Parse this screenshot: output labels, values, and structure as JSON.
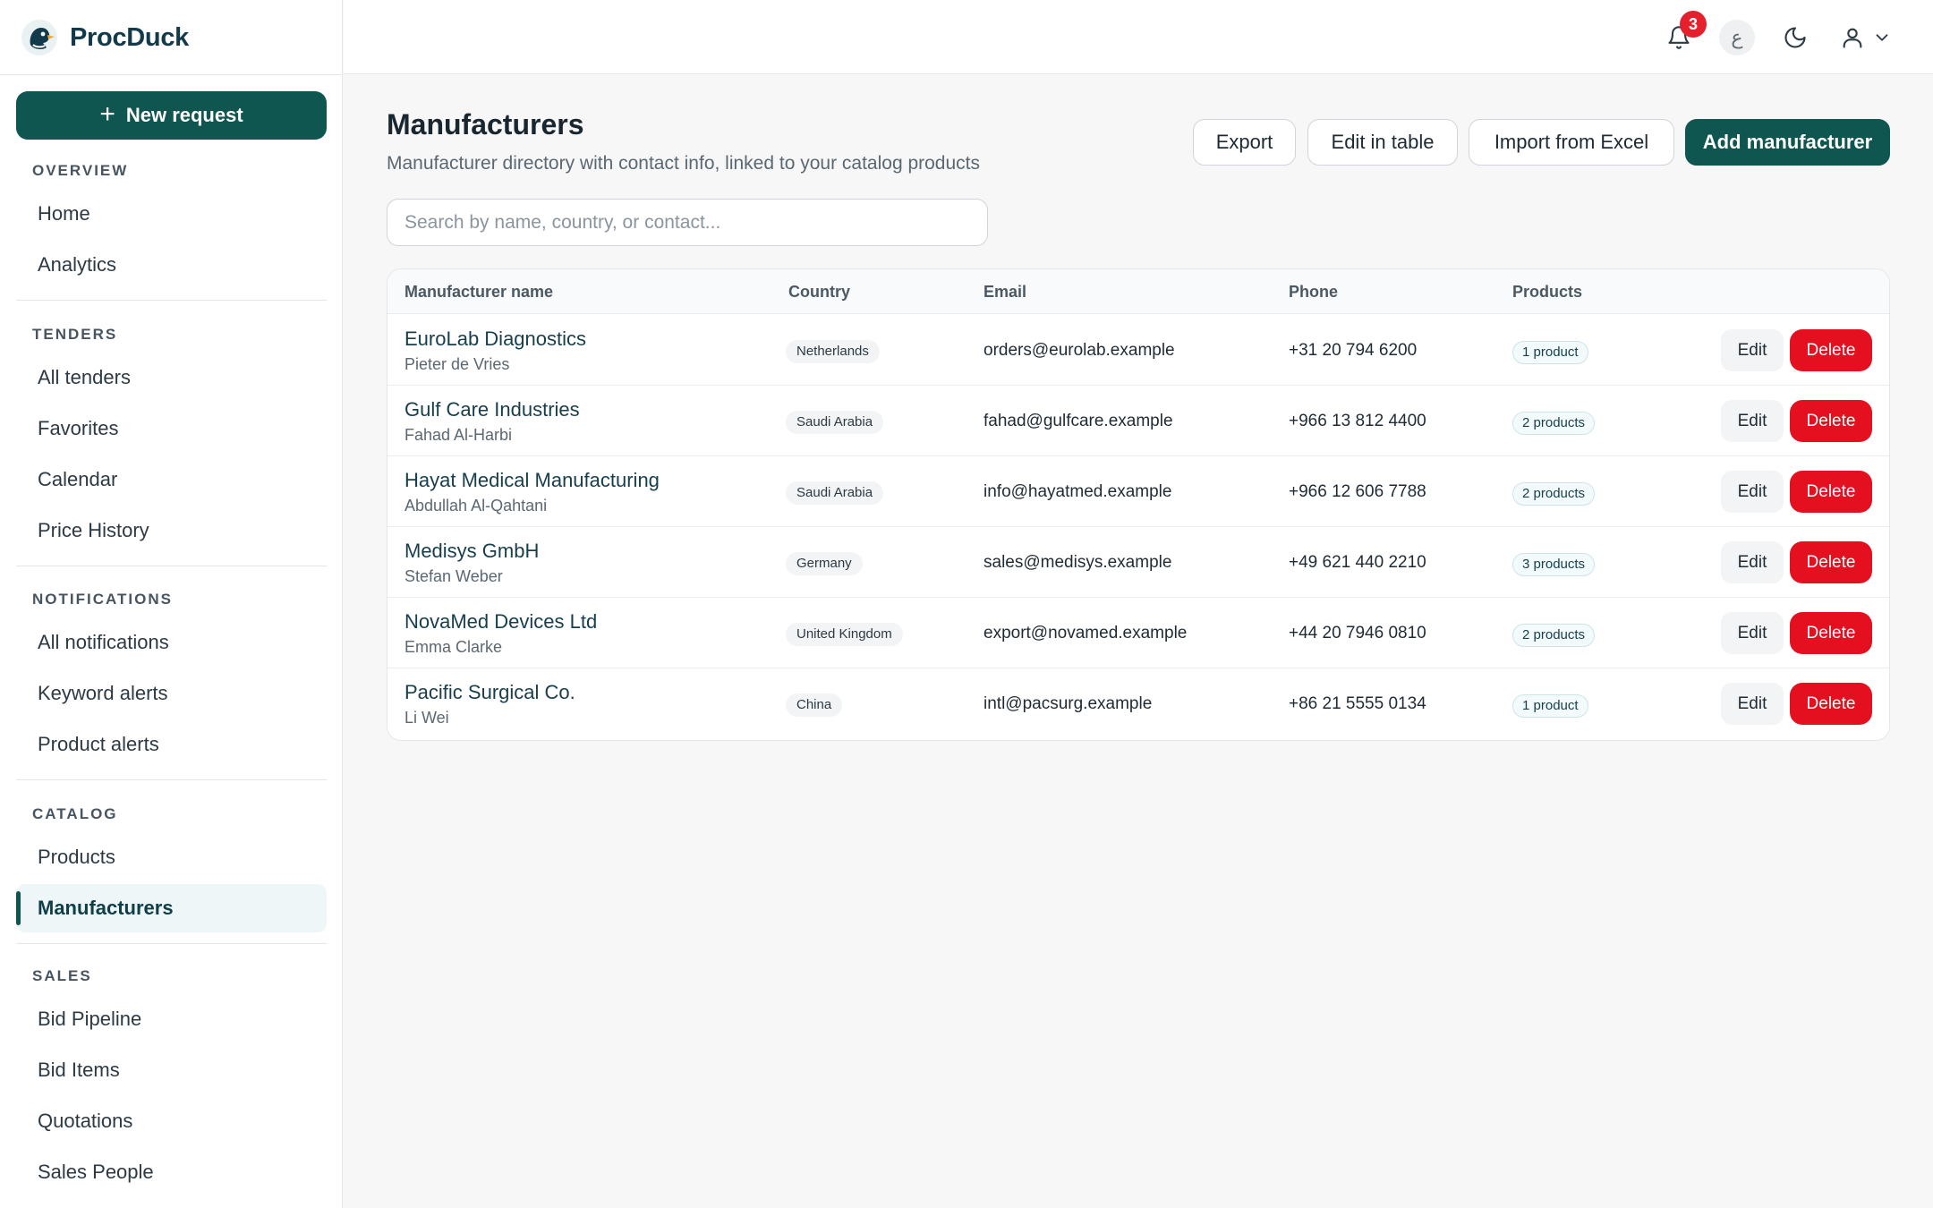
{
  "app": {
    "name": "ProcDuck"
  },
  "sidebar": {
    "new_request_label": "New request",
    "sections": [
      {
        "heading": "OVERVIEW",
        "items": [
          "Home",
          "Analytics"
        ]
      },
      {
        "heading": "TENDERS",
        "items": [
          "All tenders",
          "Favorites",
          "Calendar",
          "Price History"
        ]
      },
      {
        "heading": "NOTIFICATIONS",
        "items": [
          "All notifications",
          "Keyword alerts",
          "Product alerts"
        ]
      },
      {
        "heading": "CATALOG",
        "items": [
          "Products",
          "Manufacturers"
        ]
      },
      {
        "heading": "SALES",
        "items": [
          "Bid Pipeline",
          "Bid Items",
          "Quotations",
          "Sales People"
        ]
      }
    ],
    "active_item": "Manufacturers"
  },
  "topbar": {
    "notification_count": "3",
    "language_glyph": "ع",
    "icons": [
      "bell-icon",
      "moon-icon",
      "user-icon",
      "chevron-down-icon"
    ]
  },
  "page": {
    "title": "Manufacturers",
    "subtitle": "Manufacturer directory with contact info, linked to your catalog products",
    "actions": {
      "export": "Export",
      "edit_table": "Edit in table",
      "import": "Import from Excel",
      "add": "Add manufacturer"
    },
    "search_placeholder": "Search by name, country, or contact..."
  },
  "table": {
    "headers": {
      "name": "Manufacturer name",
      "country": "Country",
      "email": "Email",
      "phone": "Phone",
      "products": "Products"
    },
    "edit_label": "Edit",
    "delete_label": "Delete",
    "rows": [
      {
        "name": "EuroLab Diagnostics",
        "contact": "Pieter de Vries",
        "country": "Netherlands",
        "email": "orders@eurolab.example",
        "phone": "+31 20 794 6200",
        "products": "1 product"
      },
      {
        "name": "Gulf Care Industries",
        "contact": "Fahad Al-Harbi",
        "country": "Saudi Arabia",
        "email": "fahad@gulfcare.example",
        "phone": "+966 13 812 4400",
        "products": "2 products"
      },
      {
        "name": "Hayat Medical Manufacturing",
        "contact": "Abdullah Al-Qahtani",
        "country": "Saudi Arabia",
        "email": "info@hayatmed.example",
        "phone": "+966 12 606 7788",
        "products": "2 products"
      },
      {
        "name": "Medisys GmbH",
        "contact": "Stefan Weber",
        "country": "Germany",
        "email": "sales@medisys.example",
        "phone": "+49 621 440 2210",
        "products": "3 products"
      },
      {
        "name": "NovaMed Devices Ltd",
        "contact": "Emma Clarke",
        "country": "United Kingdom",
        "email": "export@novamed.example",
        "phone": "+44 20 7946 0810",
        "products": "2 products"
      },
      {
        "name": "Pacific Surgical Co.",
        "contact": "Li Wei",
        "country": "China",
        "email": "intl@pacsurg.example",
        "phone": "+86 21 5555 0134",
        "products": "1 product"
      }
    ]
  },
  "colors": {
    "accent": "#0f5550",
    "danger": "#e5101f",
    "badge": "#e5202c"
  }
}
